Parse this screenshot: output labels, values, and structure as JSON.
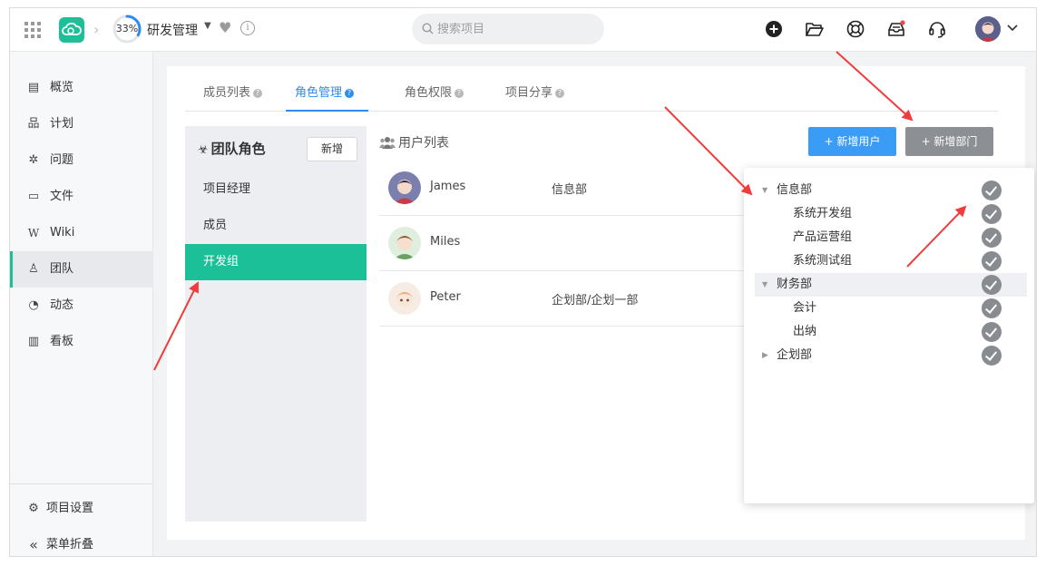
{
  "topbar": {
    "progress": "33%",
    "progress_fraction": 0.33,
    "project_name": "研发管理",
    "search_placeholder": "搜索项目"
  },
  "sidebar": {
    "items": [
      {
        "label": "概览",
        "icon": "overview-icon",
        "glyph": "▤"
      },
      {
        "label": "计划",
        "icon": "plan-icon",
        "glyph": "品"
      },
      {
        "label": "问题",
        "icon": "bug-icon",
        "glyph": "✲"
      },
      {
        "label": "文件",
        "icon": "folder-icon",
        "glyph": "▭"
      },
      {
        "label": "Wiki",
        "icon": "wiki-icon",
        "glyph": "W"
      },
      {
        "label": "团队",
        "icon": "team-icon",
        "glyph": "♙"
      },
      {
        "label": "动态",
        "icon": "activity-icon",
        "glyph": "◔"
      },
      {
        "label": "看板",
        "icon": "board-icon",
        "glyph": "▥"
      }
    ],
    "settings": {
      "label": "项目设置",
      "glyph": "⚙"
    },
    "collapse": {
      "label": "菜单折叠",
      "glyph": "«"
    }
  },
  "tabs": [
    {
      "label": "成员列表"
    },
    {
      "label": "角色管理"
    },
    {
      "label": "角色权限"
    },
    {
      "label": "项目分享"
    }
  ],
  "roles": {
    "title": "团队角色",
    "add_label": "新增",
    "items": [
      {
        "label": "项目经理"
      },
      {
        "label": "成员"
      },
      {
        "label": "开发组"
      }
    ]
  },
  "users": {
    "title": "用户列表",
    "add_user_label": "+ 新增用户",
    "add_dept_label": "+ 新增部门",
    "rows": [
      {
        "name": "James",
        "dept": "信息部"
      },
      {
        "name": "Miles",
        "dept": ""
      },
      {
        "name": "Peter",
        "dept": "企划部/企划一部"
      }
    ]
  },
  "dept_tree": [
    {
      "label": "信息部",
      "expanded": true
    },
    {
      "label": "系统开发组"
    },
    {
      "label": "产品运营组"
    },
    {
      "label": "系统测试组"
    },
    {
      "label": "财务部",
      "expanded": true
    },
    {
      "label": "会计"
    },
    {
      "label": "出纳"
    },
    {
      "label": "企划部",
      "expanded": false
    }
  ],
  "colors": {
    "accent": "#1bbf98",
    "primary_blue": "#3a9cf5",
    "annotation_red": "#f03c3c"
  }
}
